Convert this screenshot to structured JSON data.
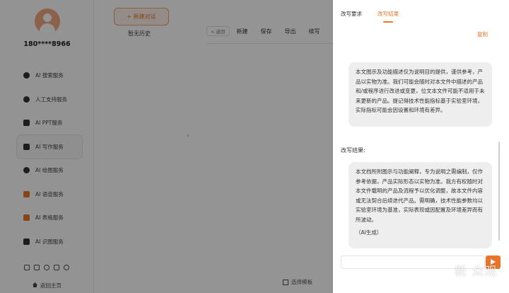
{
  "sidebar": {
    "user_phone": "180****8966",
    "items": [
      {
        "label": "AI 搜索服务",
        "icon": "search-service-icon"
      },
      {
        "label": "人工支持服务",
        "icon": "human-support-icon"
      },
      {
        "label": "AI PPT服务",
        "icon": "ppt-icon"
      },
      {
        "label": "AI 写作服务",
        "icon": "writing-icon"
      },
      {
        "label": "AI 绘图服务",
        "icon": "drawing-icon"
      },
      {
        "label": "AI 语音服务",
        "icon": "voice-icon"
      },
      {
        "label": "AI 表格服务",
        "icon": "table-icon"
      },
      {
        "label": "AI 识图服务",
        "icon": "image-recognition-icon"
      }
    ],
    "active_item": "AI 写作服务",
    "home_link": "返回主页"
  },
  "history": {
    "new_chat": "+ 新建对话",
    "empty": "暂无历史"
  },
  "editor": {
    "back": "< 返回",
    "toolbar": [
      "新建",
      "保存",
      "导出",
      "续写"
    ],
    "bottom_label": "选择模板"
  },
  "drawer": {
    "tabs": [
      "改写要求",
      "改写结果"
    ],
    "active_tab": "改写结果",
    "copy": "复制",
    "original_text": "本文图示及功能描述仅为说明目的提供，谨供参考，产品以实物为准。我们可能会随时对本文件中描述的产品和/或程序进行改进或变更，位文本文件可能不适用于未来更新的产品。提记得技术性能指标基于实验室环境，实际指标可能会因设置和环境有差异。",
    "result_label": "改写结果:",
    "result_text": "本文档所附图示与功能阐释，专为说明之需编制，仅作参考依据，产品实际形态以实物为准。我方有权随时对本文件载明的产品及流程予以优化调整，故本文件内容或无法契合后续迭代产品。需明确，技术性能参数均以实验室环境为基准，实际表现或因配置及环境差异而有所波动。",
    "ai_tag": "（AI生成）"
  },
  "watermark": "新 众观",
  "colors": {
    "accent": "#e8752a",
    "bubble": "#eeeeee",
    "overlay": "rgba(0,0,0,0.42)"
  }
}
